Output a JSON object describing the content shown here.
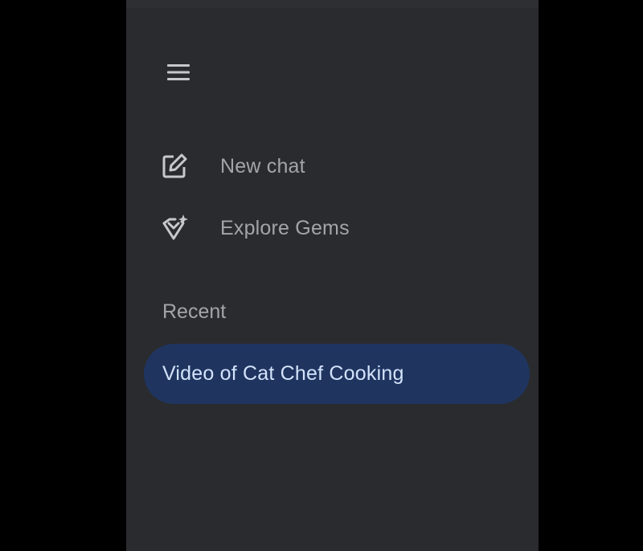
{
  "sidebar": {
    "menu_icon": "hamburger-menu-icon",
    "items": [
      {
        "label": "New chat",
        "icon": "edit-pencil-icon"
      },
      {
        "label": "Explore Gems",
        "icon": "gem-sparkle-icon"
      }
    ],
    "recent_heading": "Recent",
    "recent_items": [
      {
        "label": "Video of Cat Chef Cooking",
        "selected": true
      }
    ]
  },
  "colors": {
    "page_background": "#000000",
    "sidebar_background": "#2a2b2e",
    "text_muted": "#a3a5aa",
    "selected_background": "#1f3560",
    "selected_text": "#d4e3fb"
  }
}
